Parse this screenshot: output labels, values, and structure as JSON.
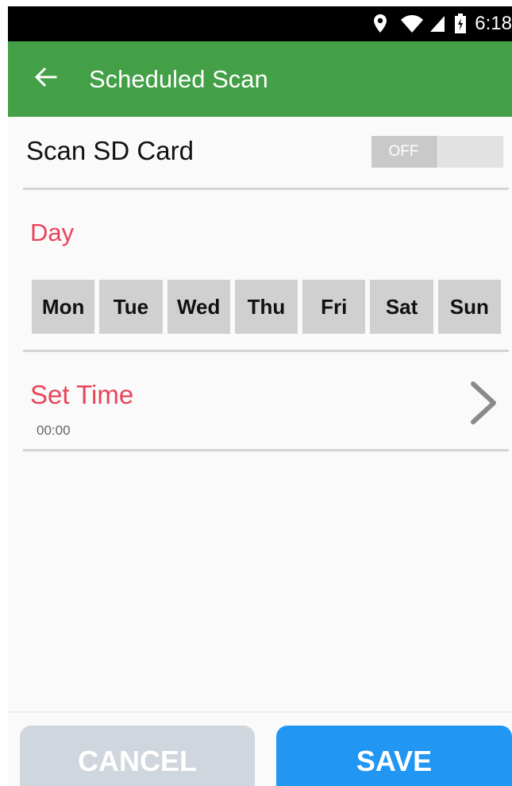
{
  "status_bar": {
    "time": "6:18",
    "icons": [
      "location-icon",
      "wifi-icon",
      "signal-icon",
      "battery-icon"
    ]
  },
  "app_bar": {
    "title": "Scheduled Scan",
    "back_icon": "arrow-left-icon",
    "color": "#43a047"
  },
  "sd_card": {
    "label": "Scan SD Card",
    "toggle_state": "OFF"
  },
  "day_section": {
    "label": "Day",
    "days": [
      "Mon",
      "Tue",
      "Wed",
      "Thu",
      "Fri",
      "Sat",
      "Sun"
    ]
  },
  "time_section": {
    "label": "Set Time",
    "value": "00:00",
    "chevron_icon": "chevron-right-icon"
  },
  "buttons": {
    "cancel": "CANCEL",
    "save": "SAVE"
  },
  "colors": {
    "accent_red": "#e8445a",
    "save_blue": "#2196f3",
    "cancel_grey": "#d0d6dd",
    "day_button_grey": "#d0d0d0"
  }
}
